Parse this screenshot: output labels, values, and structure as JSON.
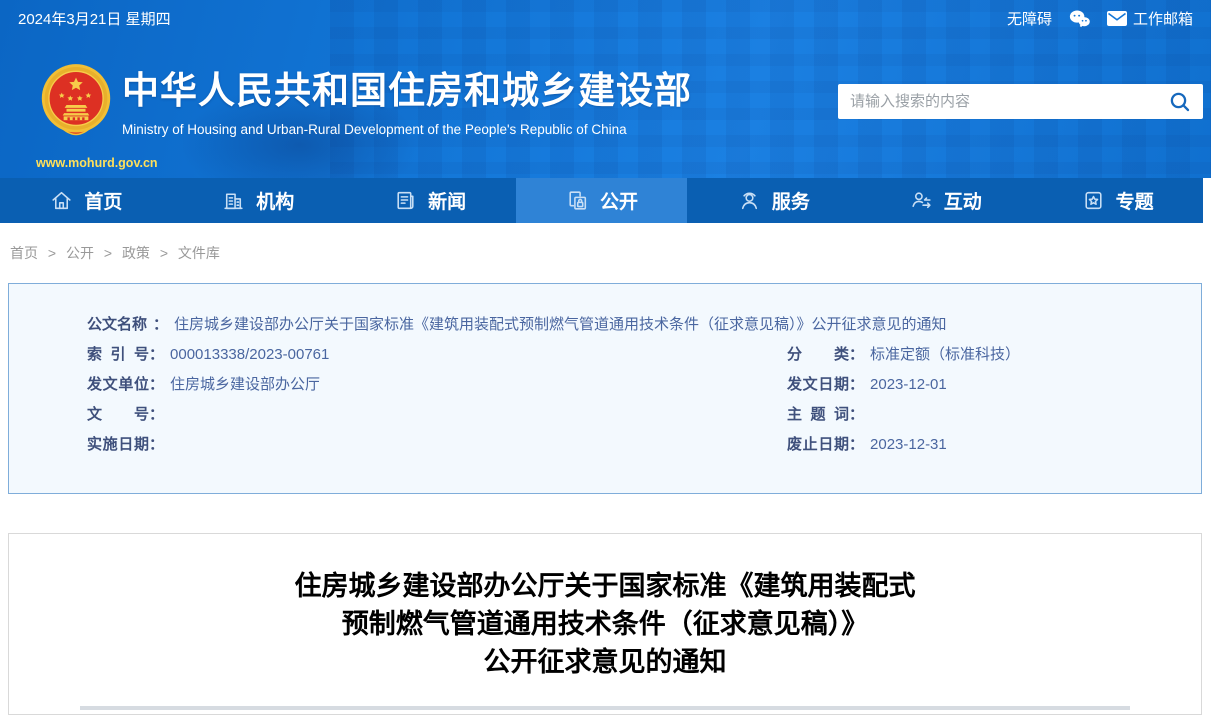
{
  "topbar": {
    "date": "2024年3月21日 星期四",
    "accessibility_label": "无障碍",
    "mailbox_label": "工作邮箱"
  },
  "header": {
    "site_name": "中华人民共和国住房和城乡建设部",
    "site_name_en": "Ministry of Housing and Urban-Rural Development of the People's Republic of China",
    "site_url": "www.mohurd.gov.cn",
    "search_placeholder": "请输入搜索的内容"
  },
  "nav": {
    "items": [
      {
        "label": "首页",
        "icon": "home-icon",
        "active": false
      },
      {
        "label": "机构",
        "icon": "organization-icon",
        "active": false
      },
      {
        "label": "新闻",
        "icon": "news-icon",
        "active": false
      },
      {
        "label": "公开",
        "icon": "disclosure-icon",
        "active": true
      },
      {
        "label": "服务",
        "icon": "service-icon",
        "active": false
      },
      {
        "label": "互动",
        "icon": "interaction-icon",
        "active": false
      },
      {
        "label": "专题",
        "icon": "special-topics-icon",
        "active": false
      }
    ]
  },
  "breadcrumb": {
    "separator": ">",
    "items": [
      "首页",
      "公开",
      "政策",
      "文件库"
    ]
  },
  "doc_info": {
    "colon": "：",
    "name_label": "公文名称",
    "name_value": "住房城乡建设部办公厅关于国家标准《建筑用装配式预制燃气管道通用技术条件（征求意见稿）》公开征求意见的通知",
    "rows": [
      {
        "left_label": "索引号",
        "left_value": "000013338/2023-00761",
        "right_label": "分类",
        "right_value": "标准定额（标准科技）"
      },
      {
        "left_label": "发文单位",
        "left_value": "住房城乡建设部办公厅",
        "right_label": "发文日期",
        "right_value": "2023-12-01"
      },
      {
        "left_label": "文号",
        "left_value": "",
        "right_label": "主题词",
        "right_value": ""
      },
      {
        "left_label": "实施日期",
        "left_value": "",
        "right_label": "废止日期",
        "right_value": "2023-12-31"
      }
    ]
  },
  "article": {
    "title_line_1": "住房城乡建设部办公厅关于国家标准《建筑用装配式",
    "title_line_2": "预制燃气管道通用技术条件（征求意见稿）》",
    "title_line_3": "公开征求意见的通知"
  },
  "colors": {
    "header_blue": "#1377d8",
    "nav_blue": "#0a5fb2",
    "nav_active_blue": "#2f83d6",
    "url_yellow": "#ffe05a",
    "docbox_bg": "#f3f9fe",
    "docbox_border": "#7fadda",
    "meta_label": "#3f507c",
    "meta_value": "#4a66a0",
    "breadcrumb_gray": "#999999",
    "divider_gray": "#d6dbe1",
    "title_black": "#000000"
  }
}
